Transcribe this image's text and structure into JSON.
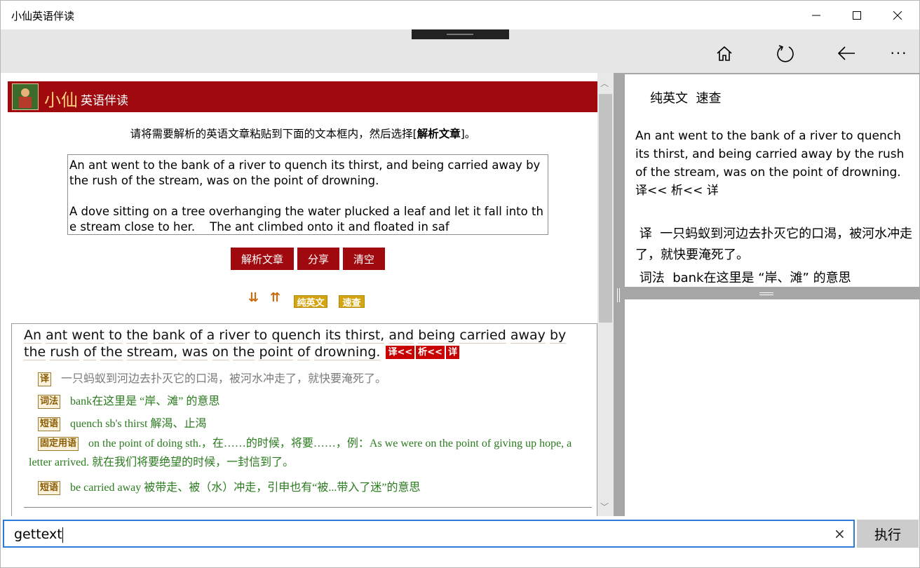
{
  "window": {
    "title": "小仙英语伴读",
    "icons": [
      "minimize-icon",
      "maximize-icon",
      "close-icon"
    ]
  },
  "commandbar": {
    "icons": [
      "home-icon",
      "refresh-icon",
      "back-arrow-icon",
      "more-icon"
    ],
    "more_label": "···"
  },
  "header": {
    "brand_main": "小仙",
    "brand_sub": "英语伴读"
  },
  "instruction": {
    "prefix": "请将需要解析的英语文章粘贴到下面的文本框内，然后选择[",
    "bold": "解析文章",
    "suffix": "]。"
  },
  "article_input": {
    "value": "An ant went to the bank of a river to quench its thirst, and being carried away by the rush of the stream, was on the point of drowning.\n\nA dove sitting on a tree overhanging the water plucked a leaf and let it fall into the stream close to her.    The ant climbed onto it and floated in saf"
  },
  "buttons": {
    "analyze": "解析文章",
    "share": "分享",
    "clear": "清空"
  },
  "view_tags": {
    "down_arrow": "⇊",
    "up_arrow": "⇈",
    "plain_english": "纯英文",
    "quick_lookup": "速查"
  },
  "analysis": {
    "sentence_words": [
      "An",
      "ant",
      "went",
      "to",
      "the",
      "bank",
      "of",
      "a",
      "river",
      "to",
      "quench",
      "its",
      "thirst,",
      "and",
      "being",
      "carried",
      "away",
      "by",
      "the",
      "rush",
      "of",
      "the",
      "stream,",
      "was",
      "on",
      "the",
      "point",
      "of",
      "drowning."
    ],
    "tags": [
      "译<<",
      "析<<",
      "详"
    ],
    "rows": [
      {
        "label": "译",
        "text": "一只蚂蚁到河边去扑灭它的口渴，被河水冲走了，就快要淹死了。"
      },
      {
        "label": "词法",
        "text": "bank在这里是 “岸、滩” 的意思"
      },
      {
        "label": "短语",
        "text": "quench sb's thirst 解渴、止渴"
      },
      {
        "label": "固定用语",
        "text": "on the point of doing sth.，在……的时候，将要……，例：As we were on the point of giving up hope, a letter arrived. 就在我们将要绝望的时候，一封信到了。"
      },
      {
        "label": "短语",
        "text": "be carried away 被带走、被（水）冲走，引申也有“被...带入了迷”的意思"
      }
    ]
  },
  "right_panel": {
    "link_plain": "纯英文",
    "link_lookup": "速查",
    "sentence": "An ant went to the bank of a river to quench its thirst, and being carried away by the rush of the stream, was on the point of drowning.",
    "inline_links": "译<< 析<< 详",
    "translation_label": "译",
    "translation": "一只蚂蚁到河边去扑灭它的口渴，被河水冲走了，就快要淹死了。",
    "lexical_label": "词法",
    "lexical": "bank在这里是 “岸、滩” 的意思"
  },
  "bottom": {
    "command_value": "gettext",
    "clear_icon": "×",
    "execute": "执行"
  },
  "colors": {
    "brand_red": "#a0090e",
    "tag_gold": "#d4a512",
    "note_green": "#2a7a1e",
    "focus_blue": "#2b7ad6"
  }
}
